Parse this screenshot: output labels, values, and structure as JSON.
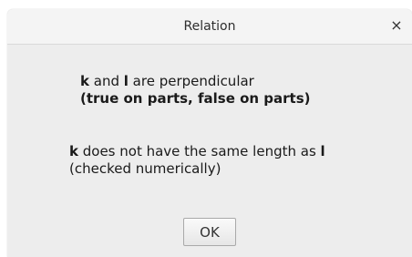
{
  "window": {
    "title": "Relation",
    "close_glyph": "×"
  },
  "message": {
    "line1": {
      "obj1": "k",
      "text1": " and ",
      "obj2": "l",
      "text2": " are perpendicular"
    },
    "line2": "(true on parts, false on parts)",
    "line3": {
      "obj1": "k",
      "text1": " does not have the same length as ",
      "obj2": "l"
    },
    "line4": "(checked numerically)"
  },
  "buttons": {
    "ok_label": "OK"
  }
}
